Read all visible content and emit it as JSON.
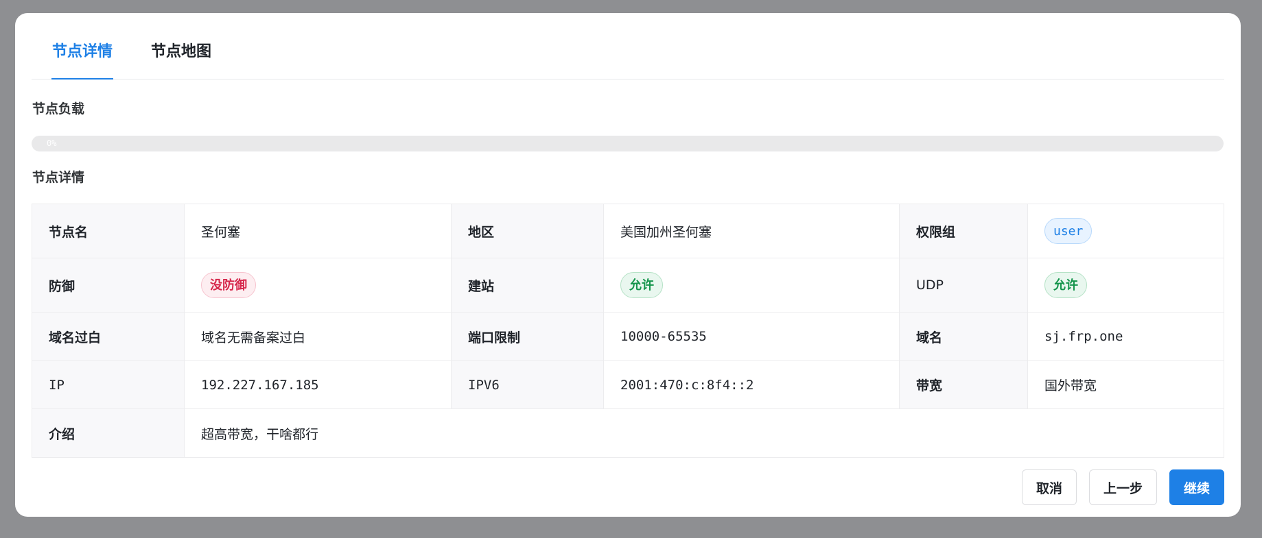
{
  "tabs": [
    {
      "label": "节点详情",
      "active": true
    },
    {
      "label": "节点地图",
      "active": false
    }
  ],
  "load": {
    "title": "节点负载",
    "percent_text": "0%",
    "percent": 0
  },
  "details": {
    "title": "节点详情",
    "node_name_label": "节点名",
    "node_name": "圣何塞",
    "region_label": "地区",
    "region": "美国加州圣何塞",
    "group_label": "权限组",
    "group": "user",
    "defense_label": "防御",
    "defense": "没防御",
    "site_label": "建站",
    "site": "允许",
    "udp_label": "UDP",
    "udp": "允许",
    "whitelist_label": "域名过白",
    "whitelist": "域名无需备案过白",
    "ports_label": "端口限制",
    "ports": "10000-65535",
    "domain_label": "域名",
    "domain": "sj.frp.one",
    "ip_label": "IP",
    "ip": "192.227.167.185",
    "ipv6_label": "IPV6",
    "ipv6": "2001:470:c:8f4::2",
    "bandwidth_label": "带宽",
    "bandwidth": "国外带宽",
    "intro_label": "介绍",
    "intro": "超高带宽，干啥都行"
  },
  "footer": {
    "cancel": "取消",
    "prev": "上一步",
    "continue": "继续"
  },
  "colors": {
    "accent": "#1e80e6",
    "danger": "#d6284c",
    "success": "#15954c"
  }
}
